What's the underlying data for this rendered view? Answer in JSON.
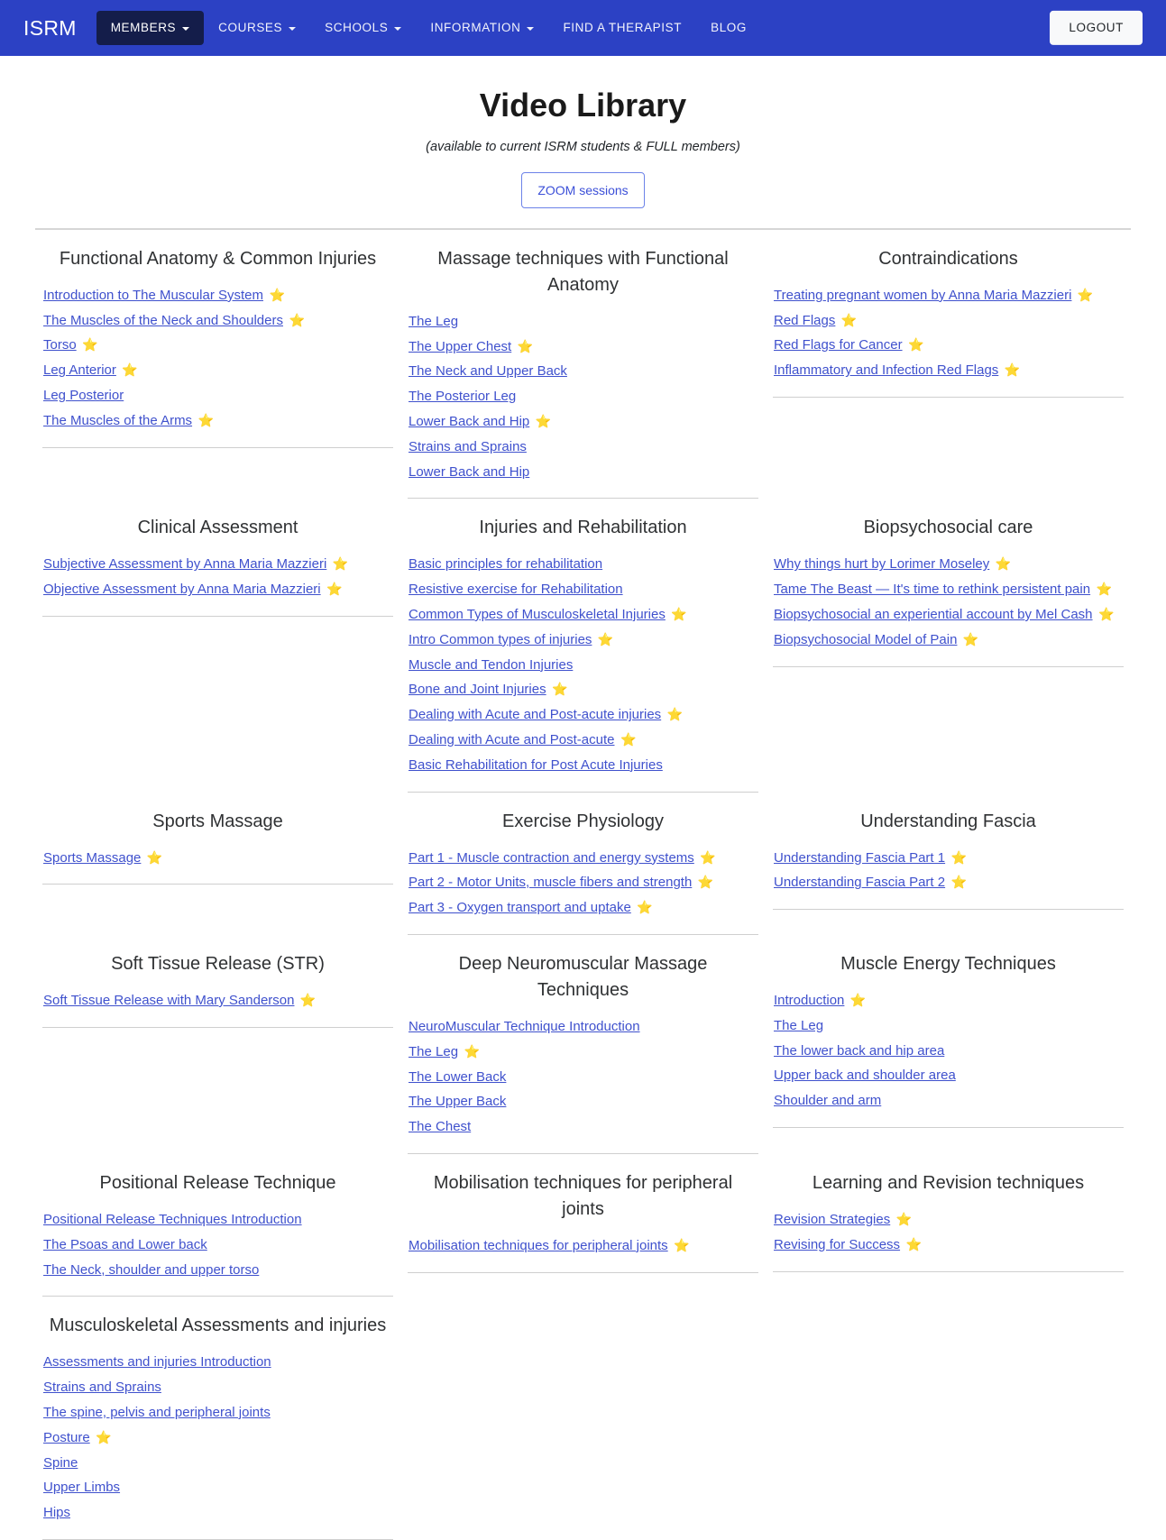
{
  "navbar": {
    "brand": "ISRM",
    "items": [
      {
        "label": "MEMBERS",
        "has_caret": true,
        "active": true
      },
      {
        "label": "COURSES",
        "has_caret": true,
        "active": false
      },
      {
        "label": "SCHOOLS",
        "has_caret": true,
        "active": false
      },
      {
        "label": "INFORMATION",
        "has_caret": true,
        "active": false
      },
      {
        "label": "FIND A THERAPIST",
        "has_caret": false,
        "active": false
      },
      {
        "label": "BLOG",
        "has_caret": false,
        "active": false
      }
    ],
    "logout_label": "LOGOUT",
    "background_color": "#2c41c4",
    "active_item_color": "#141d4a"
  },
  "page": {
    "title": "Video Library",
    "subtitle": "(available to current ISRM students & FULL members)",
    "zoom_button_label": "ZOOM sessions",
    "link_color": "#3f51cd",
    "star_color": "#f0a72a"
  },
  "sections": [
    {
      "title": "Functional Anatomy & Common Injuries",
      "links": [
        {
          "label": "Introduction to The Muscular System",
          "star": true
        },
        {
          "label": "The Muscles of the Neck and Shoulders",
          "star": true
        },
        {
          "label": "Torso",
          "star": true
        },
        {
          "label": "Leg Anterior",
          "star": true
        },
        {
          "label": "Leg Posterior",
          "star": false
        },
        {
          "label": "The Muscles of the Arms",
          "star": true
        }
      ]
    },
    {
      "title": "Massage techniques with Functional Anatomy",
      "links": [
        {
          "label": "The Leg",
          "star": false
        },
        {
          "label": "The Upper Chest",
          "star": true
        },
        {
          "label": "The Neck and Upper Back",
          "star": false
        },
        {
          "label": "The Posterior Leg",
          "star": false
        },
        {
          "label": "Lower Back and Hip",
          "star": true
        },
        {
          "label": "Strains and Sprains",
          "star": false
        },
        {
          "label": "Lower Back and Hip",
          "star": false
        }
      ]
    },
    {
      "title": "Contraindications",
      "links": [
        {
          "label": "Treating pregnant women by Anna Maria Mazzieri",
          "star": true
        },
        {
          "label": "Red Flags",
          "star": true
        },
        {
          "label": "Red Flags for Cancer",
          "star": true
        },
        {
          "label": "Inflammatory and Infection Red Flags",
          "star": true
        }
      ]
    },
    {
      "title": "Clinical Assessment",
      "links": [
        {
          "label": "Subjective Assessment by Anna Maria Mazzieri",
          "star": true
        },
        {
          "label": "Objective Assessment by Anna Maria Mazzieri",
          "star": true
        }
      ]
    },
    {
      "title": "Injuries and Rehabilitation",
      "links": [
        {
          "label": "Basic principles for rehabilitation",
          "star": false
        },
        {
          "label": "Resistive exercise for Rehabilitation",
          "star": false
        },
        {
          "label": "Common Types of Musculoskeletal Injuries",
          "star": true
        },
        {
          "label": "Intro Common types of injuries",
          "star": true
        },
        {
          "label": "Muscle and Tendon Injuries",
          "star": false
        },
        {
          "label": "Bone and Joint Injuries",
          "star": true
        },
        {
          "label": "Dealing with Acute and Post-acute injuries",
          "star": true
        },
        {
          "label": "Dealing with Acute and Post-acute",
          "star": true
        },
        {
          "label": "Basic Rehabilitation for Post Acute Injuries",
          "star": false
        }
      ]
    },
    {
      "title": "Biopsychosocial care",
      "links": [
        {
          "label": "Why things hurt by Lorimer Moseley",
          "star": true
        },
        {
          "label": "Tame The Beast — It's time to rethink persistent pain",
          "star": true
        },
        {
          "label": "Biopsychosocial an experiential account by Mel Cash",
          "star": true
        },
        {
          "label": "Biopsychosocial Model of Pain",
          "star": true
        }
      ]
    },
    {
      "title": "Sports Massage",
      "links": [
        {
          "label": "Sports Massage",
          "star": true
        }
      ]
    },
    {
      "title": "Exercise Physiology",
      "links": [
        {
          "label": "Part 1 - Muscle contraction and energy systems",
          "star": true
        },
        {
          "label": "Part 2 - Motor Units, muscle fibers and strength",
          "star": true
        },
        {
          "label": "Part 3 - Oxygen transport and uptake",
          "star": true
        }
      ]
    },
    {
      "title": "Understanding Fascia",
      "links": [
        {
          "label": "Understanding Fascia Part 1",
          "star": true
        },
        {
          "label": "Understanding Fascia Part 2",
          "star": true
        }
      ]
    },
    {
      "title": "Soft Tissue Release (STR)",
      "links": [
        {
          "label": "Soft Tissue Release with Mary Sanderson",
          "star": true
        }
      ]
    },
    {
      "title": "Deep Neuromuscular Massage Techniques",
      "links": [
        {
          "label": "NeuroMuscular Technique Introduction",
          "star": false
        },
        {
          "label": "The Leg",
          "star": true
        },
        {
          "label": "The Lower Back",
          "star": false
        },
        {
          "label": "The Upper Back",
          "star": false
        },
        {
          "label": "The Chest",
          "star": false
        }
      ]
    },
    {
      "title": "Muscle Energy Techniques",
      "links": [
        {
          "label": "Introduction",
          "star": true
        },
        {
          "label": "The Leg",
          "star": false
        },
        {
          "label": "The lower back and hip area",
          "star": false
        },
        {
          "label": "Upper back and shoulder area",
          "star": false
        },
        {
          "label": "Shoulder and arm",
          "star": false
        }
      ]
    },
    {
      "title": "Positional Release Technique",
      "links": [
        {
          "label": "Positional Release Techniques Introduction",
          "star": false
        },
        {
          "label": "The Psoas and Lower back",
          "star": false
        },
        {
          "label": "The Neck, shoulder and upper torso",
          "star": false
        }
      ]
    },
    {
      "title": "Mobilisation techniques for peripheral joints",
      "links": [
        {
          "label": "Mobilisation techniques for peripheral joints",
          "star": true
        }
      ]
    },
    {
      "title": "Learning and Revision techniques",
      "links": [
        {
          "label": "Revision Strategies",
          "star": true
        },
        {
          "label": "Revising for Success",
          "star": true
        }
      ]
    },
    {
      "title": "Musculoskeletal Assessments and injuries",
      "links": [
        {
          "label": "Assessments and injuries Introduction",
          "star": false
        },
        {
          "label": "Strains and Sprains",
          "star": false
        },
        {
          "label": "The spine, pelvis and peripheral joints",
          "star": false
        },
        {
          "label": "Posture",
          "star": true
        },
        {
          "label": "Spine",
          "star": false
        },
        {
          "label": "Upper Limbs",
          "star": false
        },
        {
          "label": "Hips",
          "star": false
        }
      ]
    }
  ],
  "icons": {
    "star": "⭐",
    "caret_down": "chevron-down-icon"
  }
}
